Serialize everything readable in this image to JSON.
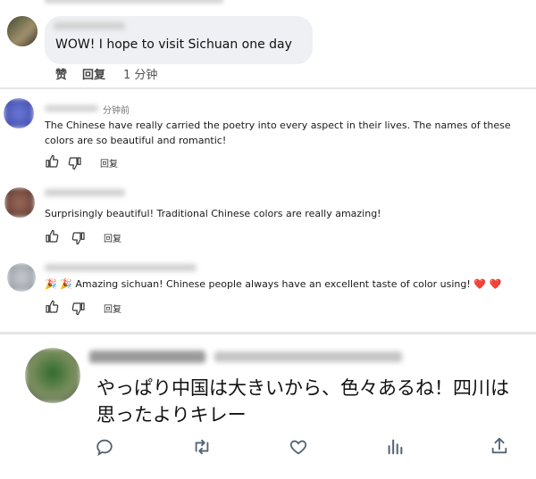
{
  "facebook_comment": {
    "text": "WOW! I hope to visit Sichuan one day",
    "like": "赞",
    "reply": "回复",
    "time": "1 分钟"
  },
  "youtube_comments": [
    {
      "time": "分钟前",
      "text": "The Chinese have really carried the poetry into every aspect in their lives. The names of these colors are so beautiful and romantic!",
      "reply": "回复"
    },
    {
      "text": "Surprisingly beautiful!  Traditional Chinese colors are really amazing!",
      "reply": "回复"
    },
    {
      "text": "🎉 🎉 Amazing sichuan! Chinese  people always have an excellent taste of color using! ❤️ ❤️",
      "reply": "回复"
    }
  ],
  "twitter_reply": {
    "text": "やっぱり中国は大きいから、色々あるね！四川は思ったよりキレー",
    "actions": [
      "reply-icon",
      "retweet-icon",
      "like-icon",
      "views-icon",
      "share-icon"
    ]
  },
  "colors": {
    "facebook_bubble": "#eef0f3",
    "text": "#111111",
    "icon_gray": "#536471"
  }
}
